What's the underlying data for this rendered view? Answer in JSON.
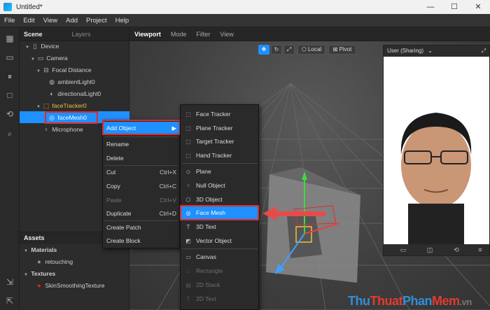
{
  "window": {
    "title": "Untitled*",
    "minimize": "—",
    "maximize": "☐",
    "close": "✕"
  },
  "menubar": [
    "File",
    "Edit",
    "View",
    "Add",
    "Project",
    "Help"
  ],
  "scene_panel": {
    "tabs": [
      "Scene",
      "Layers"
    ],
    "tree": [
      {
        "label": "Device",
        "icon": "device-icon"
      },
      {
        "label": "Camera",
        "icon": "camera-icon"
      },
      {
        "label": "Focal Distance",
        "icon": "focal-distance-icon"
      },
      {
        "label": "ambientLight0",
        "icon": "light-icon"
      },
      {
        "label": "directionalLight0",
        "icon": "directional-light-icon"
      },
      {
        "label": "faceTracker0",
        "icon": "face-tracker-icon"
      },
      {
        "label": "faceMesh0",
        "icon": "face-mesh-icon"
      },
      {
        "label": "Microphone",
        "icon": "microphone-icon"
      }
    ]
  },
  "assets_panel": {
    "title": "Assets",
    "groups": [
      {
        "label": "Materials",
        "items": [
          "retouching"
        ]
      },
      {
        "label": "Textures",
        "items": [
          "SkinSmoothingTexture"
        ]
      }
    ]
  },
  "viewport": {
    "tabs": [
      "Viewport",
      "Mode",
      "Filter",
      "View"
    ],
    "local_label": "Local",
    "pivot_label": "Pivot"
  },
  "preview": {
    "title": "User (Sharing)"
  },
  "context_menu": [
    {
      "label": "Add Object",
      "shortcut": "▶",
      "highlight": true
    },
    {
      "label": "Rename",
      "shortcut": ""
    },
    {
      "label": "Delete",
      "shortcut": ""
    },
    {
      "label": "Cut",
      "shortcut": "Ctrl+X"
    },
    {
      "label": "Copy",
      "shortcut": "Ctrl+C"
    },
    {
      "label": "Paste",
      "shortcut": "Ctrl+V",
      "disabled": true
    },
    {
      "label": "Duplicate",
      "shortcut": "Ctrl+D"
    },
    {
      "label": "Create Patch",
      "shortcut": ""
    },
    {
      "label": "Create Block",
      "shortcut": ""
    }
  ],
  "add_object_submenu": [
    {
      "label": "Face Tracker",
      "icon": "face-tracker-icon"
    },
    {
      "label": "Plane Tracker",
      "icon": "plane-tracker-icon"
    },
    {
      "label": "Target Tracker",
      "icon": "target-tracker-icon"
    },
    {
      "label": "Hand Tracker",
      "icon": "hand-tracker-icon"
    },
    {
      "label": "Plane",
      "icon": "plane-icon"
    },
    {
      "label": "Null Object",
      "icon": "null-object-icon"
    },
    {
      "label": "3D Object",
      "icon": "3d-object-icon"
    },
    {
      "label": "Face Mesh",
      "icon": "face-mesh-icon",
      "highlight": true
    },
    {
      "label": "3D Text",
      "icon": "3d-text-icon"
    },
    {
      "label": "Vector Object",
      "icon": "vector-object-icon"
    },
    {
      "label": "Canvas",
      "icon": "canvas-icon"
    },
    {
      "label": "Rectangle",
      "icon": "rectangle-icon",
      "disabled": true
    },
    {
      "label": "2D Stack",
      "icon": "2d-stack-icon",
      "disabled": true
    },
    {
      "label": "2D Text",
      "icon": "2d-text-icon",
      "disabled": true
    }
  ],
  "watermark": {
    "p1": "Thu",
    "p2": "Thuat",
    "p3": "Phan",
    "p4": "Mem",
    "p5": ".vn"
  }
}
